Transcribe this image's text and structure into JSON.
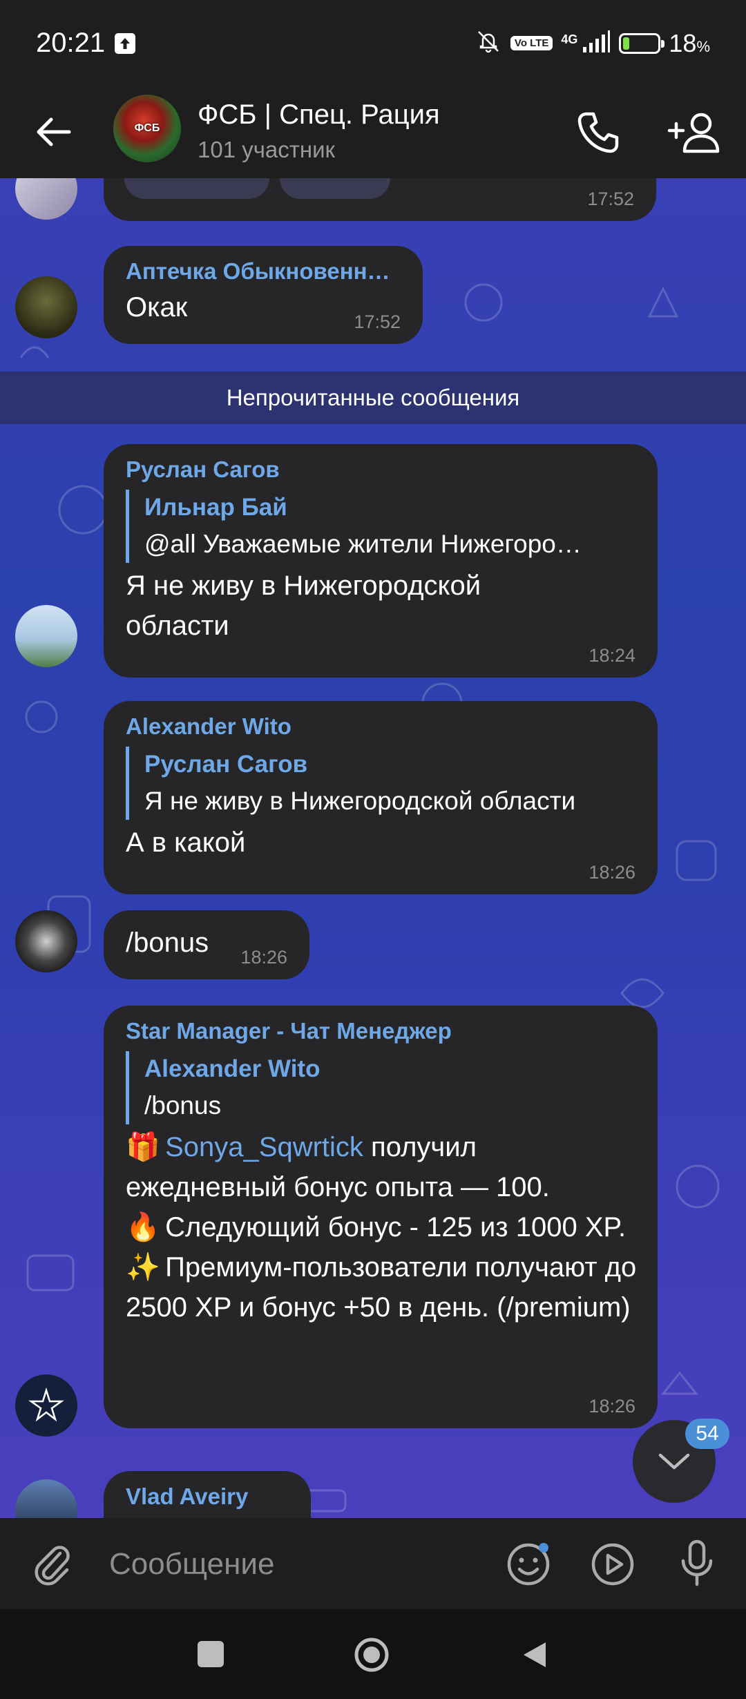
{
  "status_bar": {
    "time": "20:21",
    "volte": "Vo LTE",
    "network": "4G",
    "battery_percent": 18,
    "battery_label": "18",
    "battery_unit": "%"
  },
  "header": {
    "title": "ФСБ | Спец. Рация",
    "subtitle": "101 участник"
  },
  "chat": {
    "top_partial_time": "17:52",
    "unread_label": "Непрочитанные сообщения",
    "messages": [
      {
        "sender": "Аптечка Обыкновенн…",
        "text": "Окак",
        "time": "17:52"
      },
      {
        "sender": "Руслан Сагов",
        "reply_name": "Ильнар Бай",
        "reply_text": "@all Уважаемые жители Нижегоро…",
        "text": "Я не живу в Нижегородской области",
        "time": "18:24"
      },
      {
        "sender": "Alexander Wito",
        "reply_name": "Руслан Сагов",
        "reply_text": "Я не живу в Нижегородской области",
        "text": "А в какой",
        "time": "18:26"
      },
      {
        "text": "/bonus",
        "time": "18:26"
      },
      {
        "sender": "Star Manager - Чат Менеджер",
        "reply_name": "Alexander Wito",
        "reply_text": "/bonus",
        "line1_emoji": "🎁",
        "line1_mention": "Sonya_Sqwrtick",
        "line1_text": " получил ежедневный бонус опыта — 100.",
        "line2_emoji": "🔥",
        "line2_text": " Следующий бонус - 125 из 1000 XP.",
        "line3_emoji": "✨",
        "line3_text": " Премиум-пользователи получают до 2500 XP и бонус +50 в день. (/premium)",
        "time": "18:26"
      },
      {
        "sender": "Vlad Aveiry"
      }
    ],
    "unread_count": "54"
  },
  "input": {
    "placeholder": "Сообщение"
  },
  "icons": {
    "back": "arrow-left-icon",
    "call": "phone-icon",
    "add_user": "add-user-icon",
    "attach": "paperclip-icon",
    "sticker": "smiley-icon",
    "video": "play-circle-icon",
    "mic": "microphone-icon"
  },
  "colors": {
    "accent": "#6fa8e8",
    "bubble": "#262629",
    "badge": "#4a90d9",
    "header_bg": "#1e1e1e"
  }
}
